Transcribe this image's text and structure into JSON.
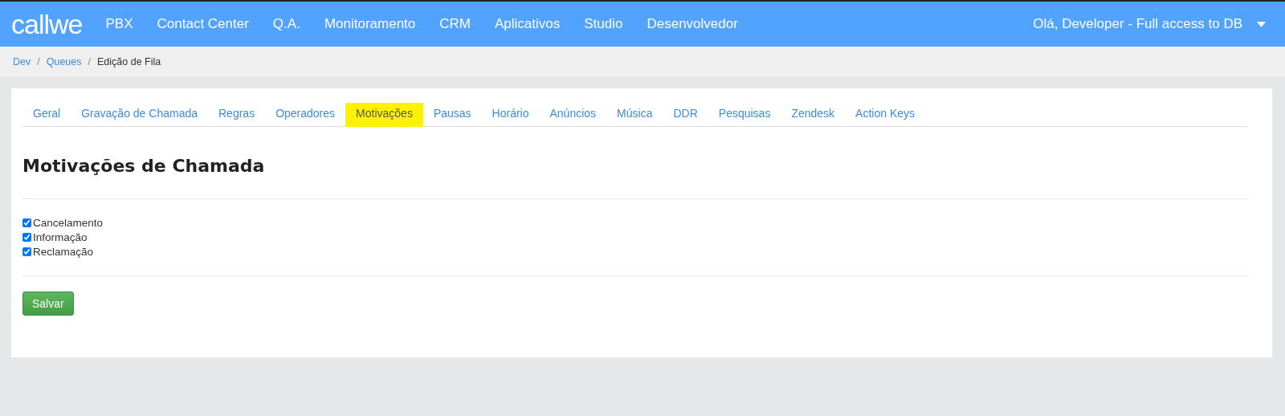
{
  "navbar": {
    "logo": "callwe",
    "items": [
      "PBX",
      "Contact Center",
      "Q.A.",
      "Monitoramento",
      "CRM",
      "Aplicativos",
      "Studio",
      "Desenvolvedor"
    ],
    "user_menu": "Olá, Developer - Full access to DB"
  },
  "breadcrumb_separator": "/",
  "breadcrumb": [
    {
      "label": "Dev",
      "kind": "link"
    },
    {
      "label": "Queues",
      "kind": "link"
    },
    {
      "label": "Edição de Fila",
      "kind": "current"
    }
  ],
  "tabs": [
    {
      "label": "Geral",
      "selected": false
    },
    {
      "label": "Gravação de Chamada",
      "selected": false
    },
    {
      "label": "Regras",
      "selected": false
    },
    {
      "label": "Operadores",
      "selected": false
    },
    {
      "label": "Motivações",
      "selected": true
    },
    {
      "label": "Pausas",
      "selected": false
    },
    {
      "label": "Horário",
      "selected": false
    },
    {
      "label": "Anúncios",
      "selected": false
    },
    {
      "label": "Música",
      "selected": false
    },
    {
      "label": "DDR",
      "selected": false
    },
    {
      "label": "Pesquisas",
      "selected": false
    },
    {
      "label": "Zendesk",
      "selected": false
    },
    {
      "label": "Action Keys",
      "selected": false
    }
  ],
  "heading": "Motivações de Chamada",
  "options": [
    {
      "label": "Cancelamento",
      "checked": true
    },
    {
      "label": "Informação",
      "checked": true
    },
    {
      "label": "Reclamação",
      "checked": true
    }
  ],
  "save_button": "Salvar"
}
